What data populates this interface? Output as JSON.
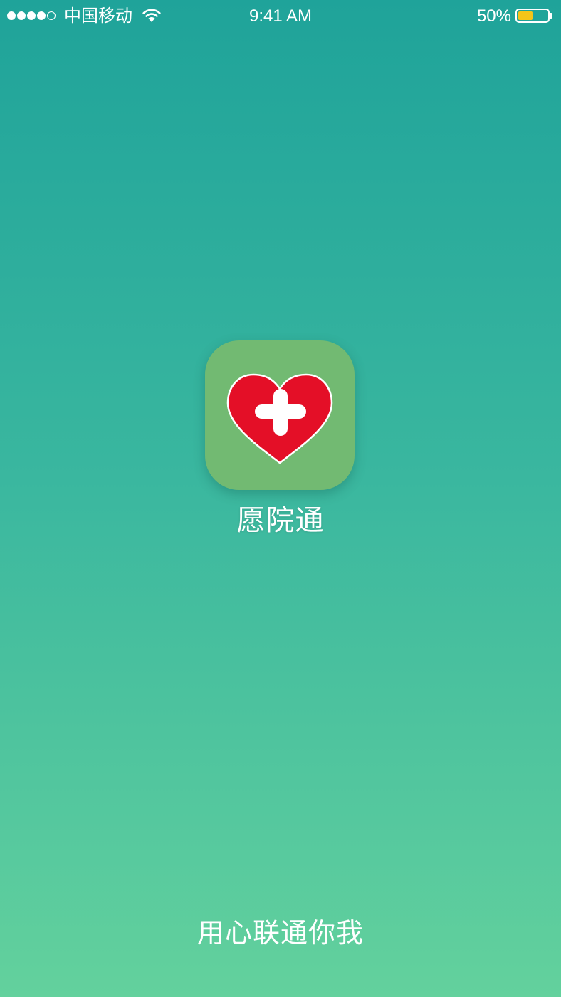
{
  "status_bar": {
    "signal_strength": 4,
    "signal_max": 5,
    "carrier": "中国移动",
    "wifi_icon": "wifi-icon",
    "time": "9:41 AM",
    "battery_text": "50%",
    "battery_icon": "battery-icon",
    "battery_level": 0.5,
    "battery_fill_color": "#F5C518"
  },
  "app": {
    "name": "愿院通",
    "icon": "heart-plus-icon",
    "icon_bg_color": "#72BA72",
    "heart_color": "#E40F27",
    "plus_color": "#FFFFFF"
  },
  "slogan": "用心联通你我",
  "colors": {
    "gradient_top": "#1FA39A",
    "gradient_middle": "#3AB79F",
    "gradient_bottom": "#63D19D"
  }
}
